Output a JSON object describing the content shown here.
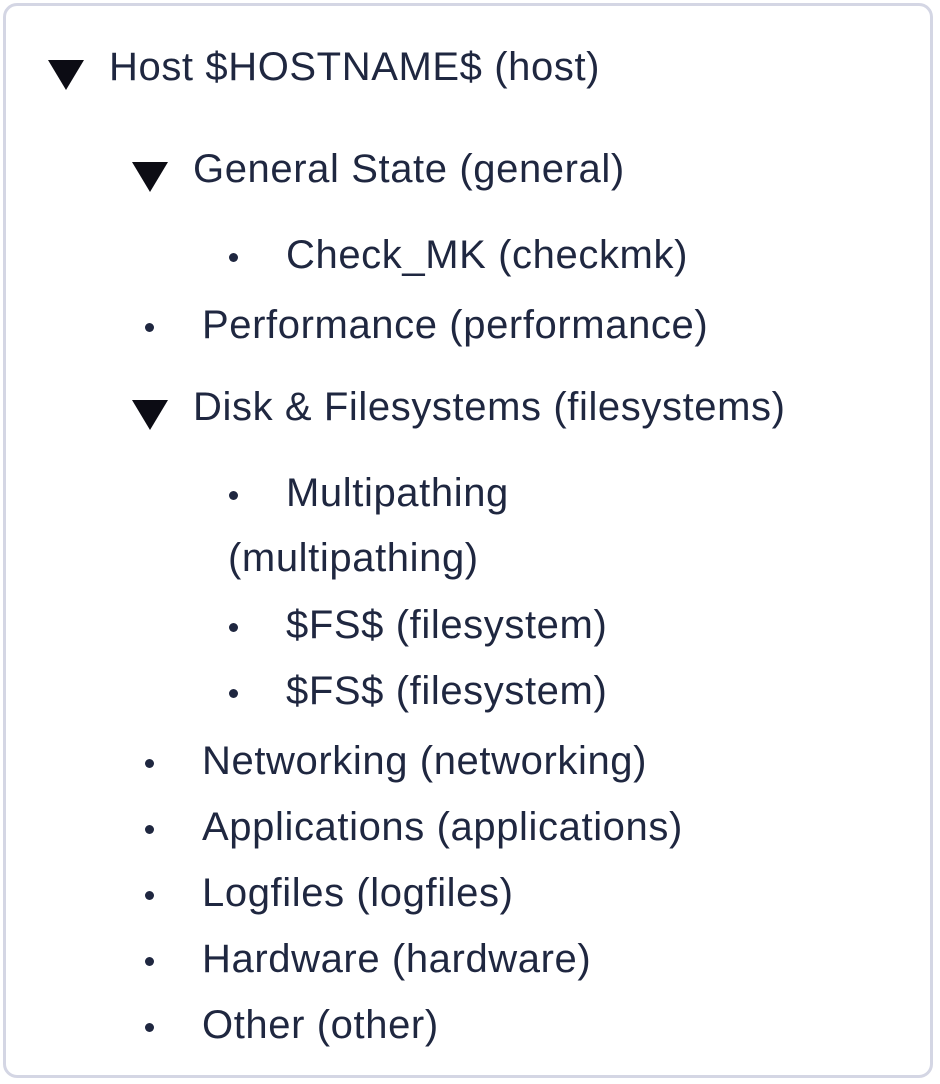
{
  "tree": {
    "root": {
      "label": "Host $HOSTNAME$ (host)",
      "icon": "triangle-down-icon",
      "children": {
        "general": {
          "label": "General State (general)",
          "icon": "triangle-down-icon",
          "children": {
            "checkmk": {
              "label": "Check_MK (checkmk)"
            }
          }
        },
        "performance": {
          "label": "Performance (performance)"
        },
        "filesystems": {
          "label": "Disk & Filesystems (filesystems)",
          "icon": "triangle-down-icon",
          "children": {
            "multipathing_line1": "Multipathing",
            "multipathing_line2": "(multipathing)",
            "fs1": "$FS$ (filesystem)",
            "fs2": "$FS$ (filesystem)"
          }
        },
        "networking": {
          "label": "Networking (networking)"
        },
        "applications": {
          "label": "Applications (applications)"
        },
        "logfiles": {
          "label": "Logfiles (logfiles)"
        },
        "hardware": {
          "label": "Hardware (hardware)"
        },
        "other": {
          "label": "Other (other)"
        }
      }
    }
  }
}
